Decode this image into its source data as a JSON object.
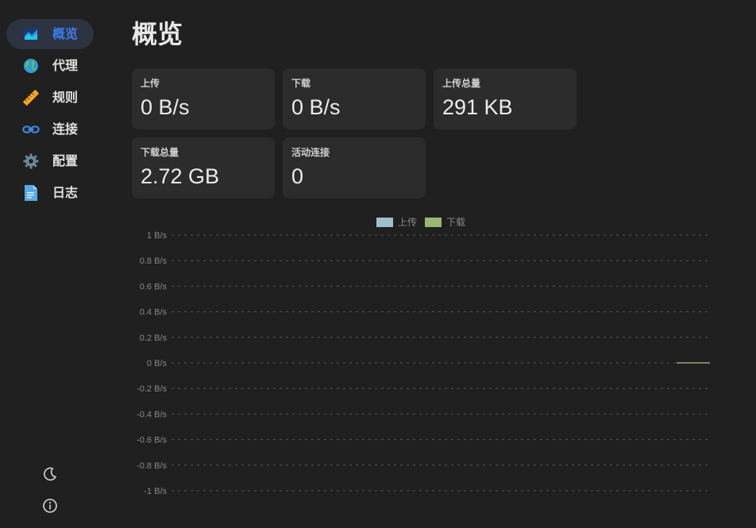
{
  "sidebar": {
    "items": [
      {
        "label": "概览",
        "icon": "chart-icon",
        "active": true
      },
      {
        "label": "代理",
        "icon": "globe-icon",
        "active": false
      },
      {
        "label": "规则",
        "icon": "ruler-icon",
        "active": false
      },
      {
        "label": "连接",
        "icon": "link-icon",
        "active": false
      },
      {
        "label": "配置",
        "icon": "gear-icon",
        "active": false
      },
      {
        "label": "日志",
        "icon": "document-icon",
        "active": false
      }
    ],
    "bottom_icons": [
      "moon-icon",
      "info-icon"
    ]
  },
  "page": {
    "title": "概览"
  },
  "stats": [
    {
      "label": "上传",
      "value": "0 B/s"
    },
    {
      "label": "下载",
      "value": "0 B/s"
    },
    {
      "label": "上传总量",
      "value": "291 KB"
    },
    {
      "label": "下载总量",
      "value": "2.72 GB"
    },
    {
      "label": "活动连接",
      "value": "0"
    }
  ],
  "colors": {
    "accent": "#3d7df0",
    "upload": "#9fbfcd",
    "download": "#9bb574"
  },
  "chart_data": {
    "type": "line",
    "series": [
      {
        "name": "上传",
        "values": [
          0,
          0
        ]
      },
      {
        "name": "下载",
        "values": [
          0,
          0
        ]
      }
    ],
    "x": [],
    "ylim": [
      -1,
      1
    ],
    "yticks": [
      "1 B/s",
      "0.8 B/s",
      "0.6 B/s",
      "0.4 B/s",
      "0.2 B/s",
      "0 B/s",
      "-0.2 B/s",
      "-0.4 B/s",
      "-0.6 B/s",
      "-0.8 B/s",
      "-1 B/s"
    ],
    "grid": true,
    "legend": "top-center"
  }
}
